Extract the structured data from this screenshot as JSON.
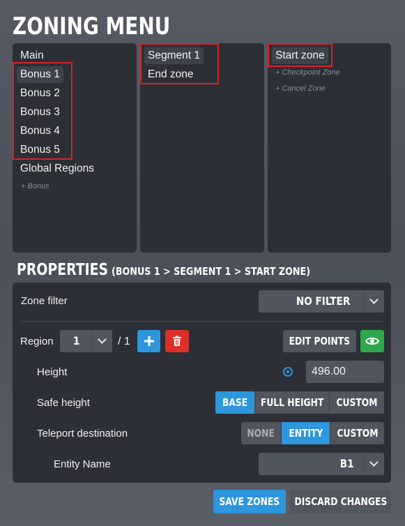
{
  "title": "ZONING MENU",
  "tracks": {
    "items": [
      "Main",
      "Bonus 1",
      "Bonus 2",
      "Bonus 3",
      "Bonus 4",
      "Bonus 5",
      "Global Regions"
    ],
    "add_label": "+ Bonus",
    "selected": "Bonus 1"
  },
  "segments": {
    "items": [
      "Segment 1",
      "End zone"
    ],
    "selected": "Segment 1"
  },
  "zones": {
    "items": [
      "Start zone"
    ],
    "add_checkpoint": "+ Checkpoint Zone",
    "add_cancel": "+ Cancel Zone",
    "selected": "Start zone"
  },
  "properties": {
    "title": "PROPERTIES",
    "path": "(BONUS 1 > SEGMENT 1 > START ZONE)",
    "zone_filter": {
      "label": "Zone filter",
      "value": "NO FILTER"
    },
    "region": {
      "label": "Region",
      "value": "1",
      "total": "/ 1",
      "edit_points": "EDIT POINTS"
    },
    "height": {
      "label": "Height",
      "value": "496.00"
    },
    "safe_height": {
      "label": "Safe height",
      "options": [
        "BASE",
        "FULL HEIGHT",
        "CUSTOM"
      ],
      "selected": "BASE"
    },
    "teleport": {
      "label": "Teleport destination",
      "options": [
        "NONE",
        "ENTITY",
        "CUSTOM"
      ],
      "selected": "ENTITY"
    },
    "entity_name": {
      "label": "Entity Name",
      "value": "B1"
    }
  },
  "footer": {
    "save": "SAVE ZONES",
    "discard": "DISCARD CHANGES"
  },
  "colors": {
    "accent": "#2d96dd",
    "danger": "#d9302a",
    "success": "#2ea84a",
    "highlight_box": "#d8232a"
  },
  "icons": [
    "plus-icon",
    "trash-icon",
    "eye-icon",
    "target-icon",
    "chevron-down-icon"
  ]
}
